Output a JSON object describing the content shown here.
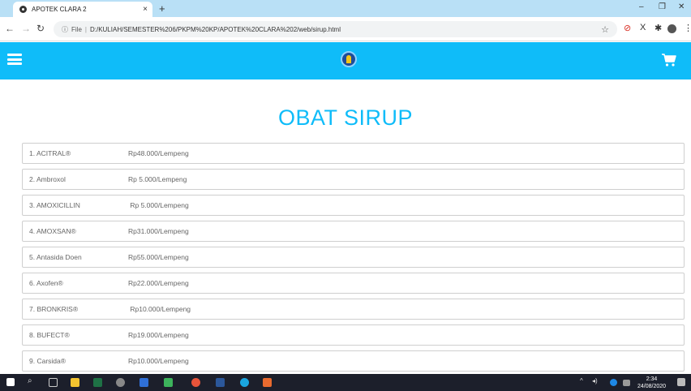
{
  "browser": {
    "tab_title": "APOTEK CLARA 2",
    "tab_close": "×",
    "new_tab": "+",
    "url_prefix": "File",
    "url_separator": "|",
    "url": "D:/KULIAH/SEMESTER%206/PKPM%20KP/APOTEK%20CLARA%202/web/sirup.html",
    "win_minimize": "–",
    "win_restore": "❐",
    "win_close": "✕"
  },
  "page": {
    "title": "OBAT SIRUP",
    "items": [
      {
        "name": "1. ACITRAL®",
        "price": "Rp48.000/Lempeng"
      },
      {
        "name": "2. Ambroxol",
        "price": "Rp 5.000/Lempeng"
      },
      {
        "name": "3. AMOXICILLIN",
        "price": " Rp 5.000/Lempeng"
      },
      {
        "name": "4. AMOXSAN®",
        "price": "Rp31.000/Lempeng"
      },
      {
        "name": "5. Antasida Doen",
        "price": "Rp55.000/Lempeng"
      },
      {
        "name": "6. Axofen®",
        "price": "Rp22.000/Lempeng"
      },
      {
        "name": "7. BRONKRIS®",
        "price": " Rp10.000/Lempeng"
      },
      {
        "name": "8. BUFECT®",
        "price": "Rp19.000/Lempeng"
      },
      {
        "name": "9. Carsida®",
        "price": "Rp10.000/Lempeng"
      }
    ]
  },
  "taskbar": {
    "time": "2:34",
    "date": "24/08/2020"
  },
  "colors": {
    "header": "#0fbcf9",
    "title": "#0fbcf9",
    "tabstrip": "#b9e0f6"
  }
}
